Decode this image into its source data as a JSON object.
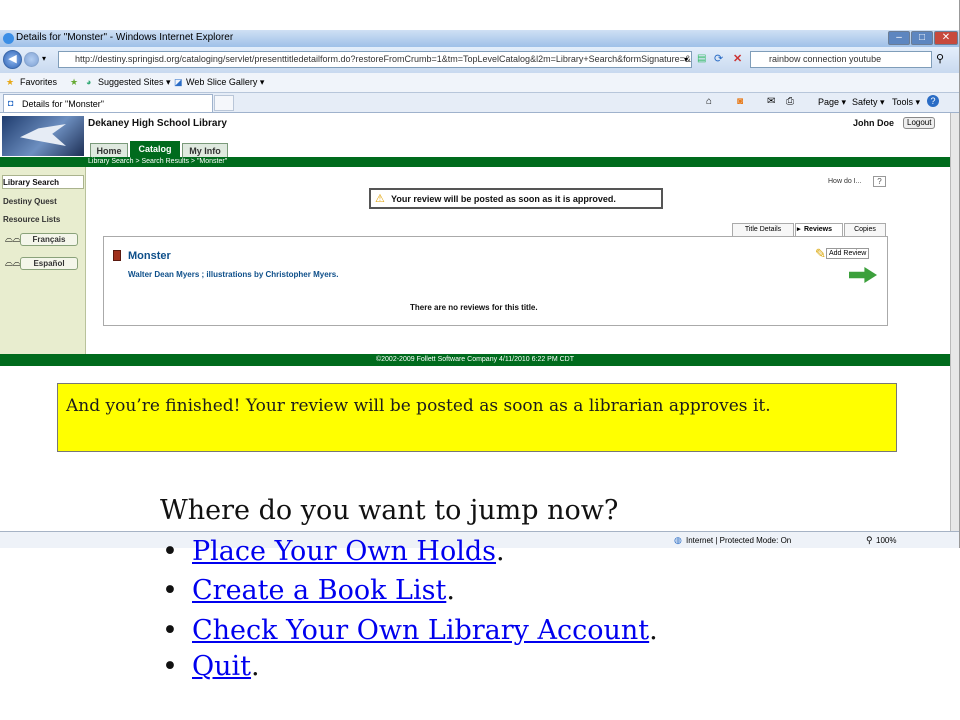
{
  "browser": {
    "window_title": "Details for \"Monster\" - Windows Internet Explorer",
    "url": "http://destiny.springisd.org/cataloging/servlet/presenttitledetailform.do?restoreFromCrumb=1&tm=TopLevelCatalog&l2m=Library+Search&formSignature=&for",
    "search_value": "rainbow connection youtube",
    "favorites_label": "Favorites",
    "suggested_sites": "Suggested Sites ▾",
    "web_slice": "Web Slice Gallery ▾",
    "tab_label": "Details for \"Monster\"",
    "cmd": {
      "page": "Page ▾",
      "safety": "Safety ▾",
      "tools": "Tools ▾"
    },
    "status_zone": "Internet | Protected Mode: On",
    "zoom": "100%"
  },
  "destiny": {
    "school": "Dekaney High School Library",
    "user": "John Doe",
    "logout": "Logout",
    "tabs": [
      "Home",
      "Catalog",
      "My Info"
    ],
    "breadcrumb": "Library Search > Search Results > \"Monster\"",
    "how_do_i": "How do I...",
    "help": "?",
    "sidebar": [
      "Library Search",
      "Destiny Quest",
      "Resource Lists"
    ],
    "languages": [
      "Français",
      "Español"
    ],
    "message": "Your review will be posted as soon as it is approved.",
    "detail_tabs": [
      "Title Details",
      "Reviews",
      "Copies"
    ],
    "title": "Monster",
    "author": "Walter Dean Myers ; illustrations by Christopher Myers.",
    "add_review": "Add Review",
    "no_reviews": "There are no reviews for this title.",
    "footer": "©2002-2009  Follett Software Company     4/11/2010 6:22 PM CDT"
  },
  "slide": {
    "note": "And you’re finished! Your review will be posted as soon as a librarian approves it.",
    "question": "Where do you want to jump now?",
    "links": [
      {
        "label": "Place Your Own Holds",
        "after": "."
      },
      {
        "label": "Create a Book List",
        "after": "."
      },
      {
        "label": "Check Your Own Library Account",
        "after": "."
      },
      {
        "label": "Quit",
        "after": "."
      }
    ]
  },
  "colors": {
    "destiny_green": "#006b1d",
    "note_yellow": "#ffff00",
    "link": "#0000ee"
  }
}
